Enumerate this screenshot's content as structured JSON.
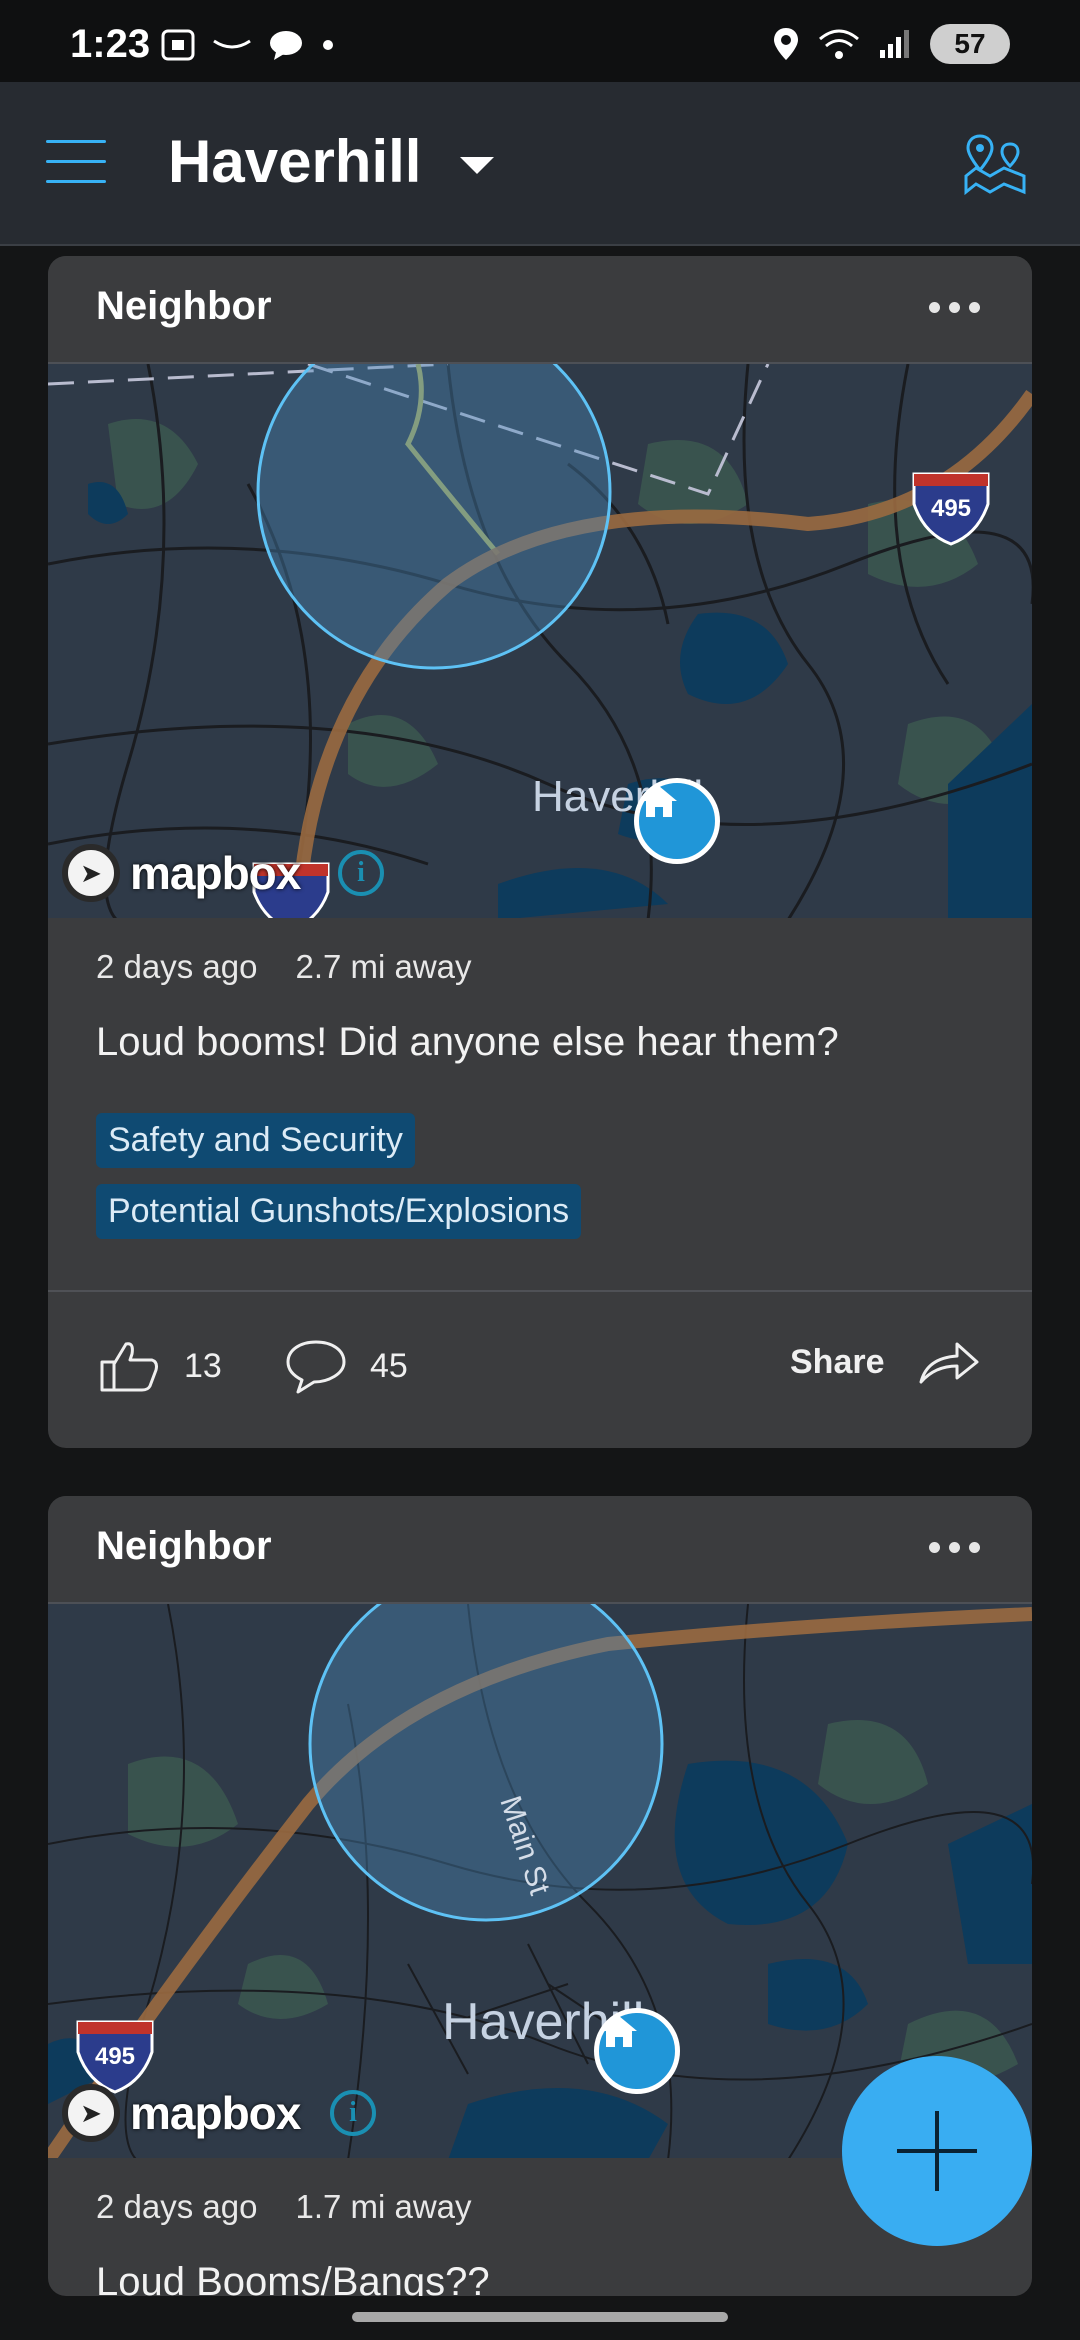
{
  "status_bar": {
    "time": "1:23",
    "battery": "57"
  },
  "header": {
    "title": "Haverhill"
  },
  "posts": [
    {
      "author": "Neighbor",
      "map_town": "Haverhill",
      "map_highway": "495",
      "map_logo": "mapbox",
      "time_ago": "2 days ago",
      "distance": "2.7 mi away",
      "text": "Loud booms! Did anyone else hear them?",
      "tags": [
        "Safety and Security",
        "Potential Gunshots/Explosions"
      ],
      "likes": "13",
      "comments": "45",
      "share_label": "Share"
    },
    {
      "author": "Neighbor",
      "map_town": "Haverhill",
      "map_street": "Main St",
      "map_highway": "495",
      "map_logo": "mapbox",
      "time_ago": "2 days ago",
      "distance": "1.7 mi away",
      "text": "Loud Booms/Bangs??"
    }
  ],
  "colors": {
    "accent": "#39adf2",
    "tag_bg": "#0f4a72",
    "card_bg": "#3b3c3e",
    "header_bg": "#272b31"
  },
  "icons": [
    "menu-icon",
    "chevron-down-icon",
    "map-pin-icon",
    "more-icon",
    "thumbs-up-icon",
    "comment-icon",
    "share-arrow-icon",
    "home-icon",
    "plus-icon"
  ]
}
